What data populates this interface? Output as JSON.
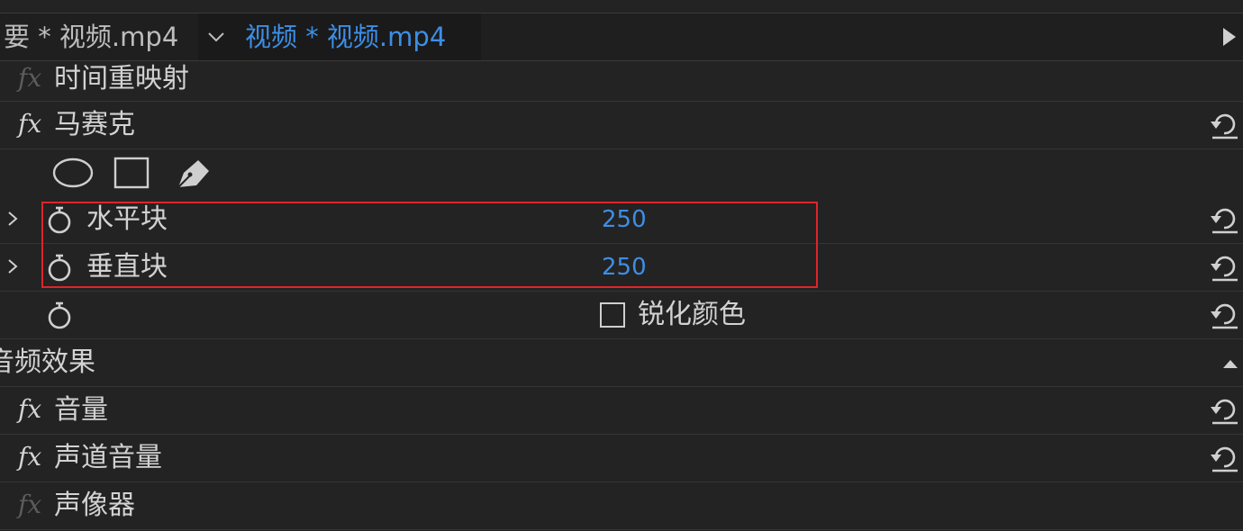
{
  "tabs": {
    "inactive_label": "要 * 视频.mp4",
    "active_label": "视频 * 视频.mp4"
  },
  "effects": {
    "time_remap": {
      "label": "时间重映射",
      "fx": "fx"
    },
    "mosaic": {
      "label": "马赛克",
      "fx": "fx",
      "mask_tools": [
        "ellipse-mask-icon",
        "rectangle-mask-icon",
        "pen-mask-icon"
      ],
      "params": [
        {
          "label": "水平块",
          "value": "250"
        },
        {
          "label": "垂直块",
          "value": "250"
        }
      ],
      "sharpen_label": "锐化颜色",
      "sharpen_checked": false
    }
  },
  "audio": {
    "section_label": "音频效果",
    "items": [
      {
        "label": "音量",
        "fx": "fx"
      },
      {
        "label": "声道音量",
        "fx": "fx"
      },
      {
        "label": "声像器",
        "fx": "fx"
      }
    ]
  },
  "colors": {
    "accent_blue": "#3d8ee6",
    "highlight_red": "#e0242a",
    "background": "#232323"
  }
}
